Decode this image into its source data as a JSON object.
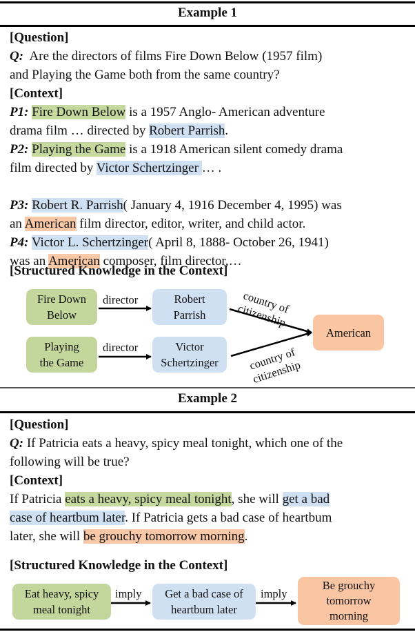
{
  "example1": {
    "title": "Example 1",
    "question_heading": "[Question]",
    "q_label": "Q:",
    "q_line1": "Are the directors of films Fire Down Below (1957 film)",
    "q_line2": "and Playing the Game both from the same country?",
    "context_heading": "[Context]",
    "p1": {
      "label": "P1:",
      "hl1": "Fire Down Below",
      "t1": " is a 1957 Anglo- American adventure",
      "t2": "drama film …  directed by ",
      "hl2": "Robert Parrish",
      "t3": "."
    },
    "p2": {
      "label": "P2:",
      "hl1": "Playing the Game",
      "t1": " is a 1918 American silent comedy drama",
      "t2": "film directed by ",
      "hl2": "Victor Schertzinger ",
      "t3": "… ."
    },
    "p3": {
      "label": "P3:",
      "hl1": "Robert R. Parrish",
      "t1": "( January 4, 1916 December 4, 1995) was",
      "t2": "an ",
      "hl2": "American",
      "t3": " film director, editor, writer, and child actor."
    },
    "p4": {
      "label": "P4:",
      "hl1": "Victor L. Schertzinger",
      "t1": "( April 8, 1888- October 26, 1941)",
      "t2": "was an ",
      "hl2": "American",
      "t3": " composer, film director,…"
    },
    "sk_heading": "[Structured Knowledge in the Context]",
    "graph": {
      "nodes": {
        "film1": [
          "Fire Down",
          "Below"
        ],
        "film2": [
          "Playing",
          "the Game"
        ],
        "person1": [
          "Robert",
          "Parrish"
        ],
        "person2": [
          "Victor",
          "Schertzinger"
        ],
        "country": "American"
      },
      "edges": {
        "director1": "director",
        "director2": "director",
        "citizen1": [
          "country of",
          "citizenship"
        ],
        "citizen2": [
          "country of",
          "citizenship"
        ]
      }
    }
  },
  "example2": {
    "title": "Example 2",
    "question_heading": "[Question]",
    "q_label": "Q:",
    "q_line1": " If Patricia eats a heavy, spicy meal tonight, which one of the",
    "q_line2": "following will be true?",
    "context_heading": "[Context]",
    "c1_pre": "If Patricia ",
    "c1_hl1": "eats a heavy, spicy meal tonight",
    "c1_mid": ", she will ",
    "c1_hl2a": "get a bad",
    "c2_hl2b": "case of heartbum later",
    "c2_post": ". If Patricia gets a bad case of heartbum",
    "c3_pre": "later, she will ",
    "c3_hl3": "be grouchy tomorrow morning",
    "c3_post": ".",
    "sk_heading": "[Structured Knowledge in the Context]",
    "chain": {
      "node1": [
        "Eat heavy, spicy",
        "meal tonight"
      ],
      "node2": [
        "Get a bad case of",
        "heartbum later"
      ],
      "node3": [
        "Be grouchy",
        "tomorrow",
        "morning"
      ],
      "edge1": "imply",
      "edge2": "imply"
    }
  }
}
